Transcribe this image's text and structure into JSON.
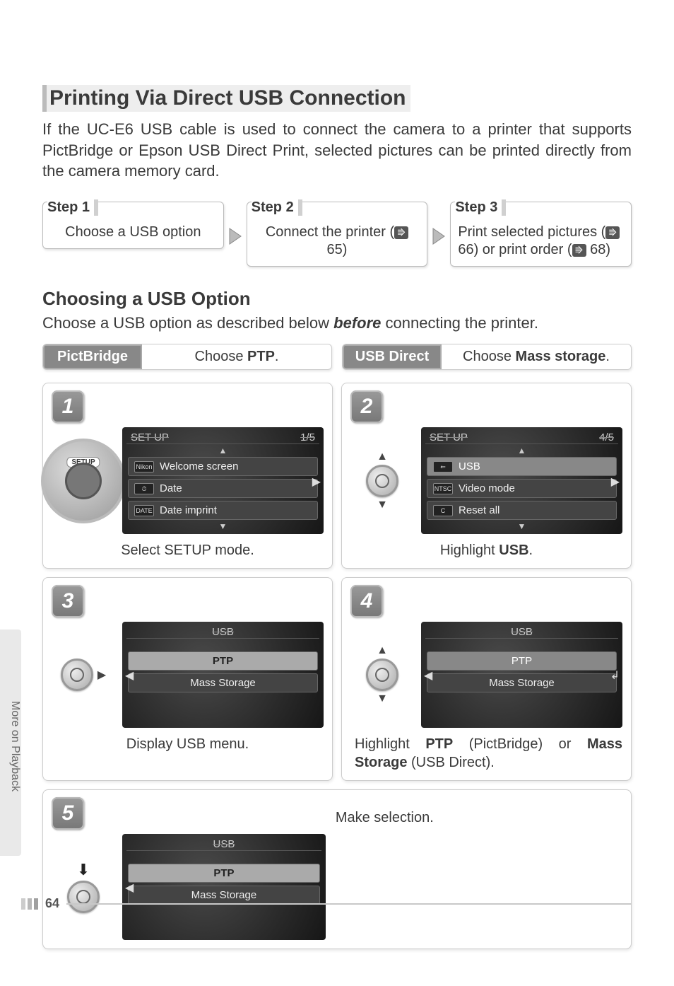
{
  "title": "Printing Via Direct USB Connection",
  "intro": "If the UC-E6 USB cable is used to connect the camera to a printer that supports PictBridge or Epson USB Direct Print, selected pictures can be printed directly from the camera memory card.",
  "steps_overview": [
    {
      "label": "Step 1",
      "text": "Choose a USB option"
    },
    {
      "label": "Step 2",
      "text_pre": "Connect the printer (",
      "page_ref": "65",
      "text_post": ")"
    },
    {
      "label": "Step 3",
      "text_pre": "Print selected pictures (",
      "page_ref1": "66",
      "mid": ") or print order (",
      "page_ref2": "68",
      "text_post": ")"
    }
  ],
  "section2_title": "Choosing a USB Option",
  "section2_intro_pre": "Choose a USB option as described below ",
  "section2_intro_bold": "before",
  "section2_intro_post": " connecting the printer.",
  "options": [
    {
      "name": "PictBridge",
      "instruction_pre": "Choose ",
      "instruction_bold": "PTP",
      "instruction_post": "."
    },
    {
      "name": "USB Direct",
      "instruction_pre": "Choose ",
      "instruction_bold": "Mass storage",
      "instruction_post": "."
    }
  ],
  "panels": {
    "p1": {
      "num": "1",
      "screen_title": "SET UP",
      "screen_page": "1/5",
      "items": [
        {
          "icon": "Nikon",
          "label": "Welcome screen"
        },
        {
          "icon": "⏱",
          "label": "Date"
        },
        {
          "icon": "DATE",
          "label": "Date imprint"
        }
      ],
      "caption": "Select SETUP mode.",
      "dial_label": "SETUP"
    },
    "p2": {
      "num": "2",
      "screen_title": "SET UP",
      "screen_page": "4/5",
      "items": [
        {
          "icon": "⇐",
          "label": "USB"
        },
        {
          "icon": "NTSC",
          "label": "Video mode"
        },
        {
          "icon": "C",
          "label": "Reset all"
        }
      ],
      "caption_pre": "Highlight ",
      "caption_bold": "USB",
      "caption_post": "."
    },
    "p3": {
      "num": "3",
      "screen_title": "USB",
      "items": [
        {
          "label": "PTP",
          "sel": true
        },
        {
          "label": "Mass Storage"
        }
      ],
      "caption": "Display USB menu."
    },
    "p4": {
      "num": "4",
      "screen_title": "USB",
      "items": [
        {
          "label": "PTP",
          "hl": true
        },
        {
          "label": "Mass Storage"
        }
      ],
      "caption_pre": "Highlight ",
      "caption_b1": "PTP",
      "caption_mid": " (PictBridge) or ",
      "caption_b2": "Mass Storage",
      "caption_post": " (USB Direct)."
    },
    "p5": {
      "num": "5",
      "screen_title": "USB",
      "items": [
        {
          "label": "PTP",
          "sel": true
        },
        {
          "label": "Mass Storage"
        }
      ],
      "caption": "Make selection."
    }
  },
  "side_tab": "More on Playback",
  "page_number": "64"
}
